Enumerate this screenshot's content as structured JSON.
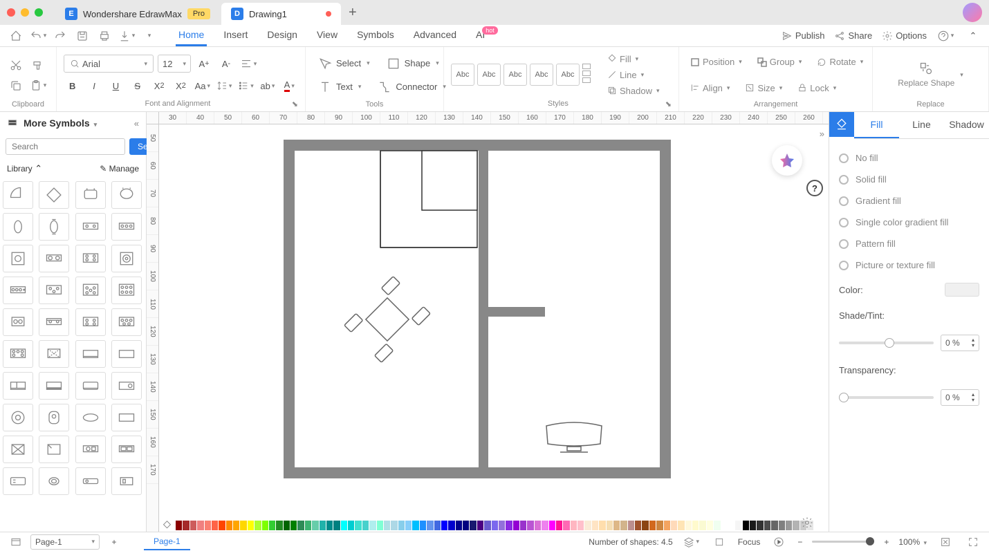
{
  "titlebar": {
    "app_name": "Wondershare EdrawMax",
    "pro_badge": "Pro",
    "doc_name": "Drawing1"
  },
  "menu": {
    "tabs": [
      "Home",
      "Insert",
      "Design",
      "View",
      "Symbols",
      "Advanced",
      "AI"
    ],
    "active": "Home",
    "hot_badge": "hot"
  },
  "top_actions": {
    "publish": "Publish",
    "share": "Share",
    "options": "Options"
  },
  "ribbon": {
    "clipboard_label": "Clipboard",
    "font_label": "Font and Alignment",
    "tools_label": "Tools",
    "styles_label": "Styles",
    "arrangement_label": "Arrangement",
    "replace_label": "Replace",
    "font_family": "Arial",
    "font_size": "12",
    "select": "Select",
    "shape": "Shape",
    "text": "Text",
    "connector": "Connector",
    "style_preview": "Abc",
    "fill": "Fill",
    "line": "Line",
    "shadow": "Shadow",
    "position": "Position",
    "group": "Group",
    "rotate": "Rotate",
    "align": "Align",
    "size": "Size",
    "lock": "Lock",
    "replace_shape": "Replace Shape"
  },
  "left_panel": {
    "title": "More Symbols",
    "search_placeholder": "Search",
    "search_btn": "Search",
    "library": "Library",
    "manage": "Manage"
  },
  "right_panel": {
    "tabs": [
      "Fill",
      "Line",
      "Shadow"
    ],
    "active": "Fill",
    "options": [
      "No fill",
      "Solid fill",
      "Gradient fill",
      "Single color gradient fill",
      "Pattern fill",
      "Picture or texture fill"
    ],
    "color_label": "Color:",
    "shade_label": "Shade/Tint:",
    "shade_value": "0 %",
    "transparency_label": "Transparency:",
    "transparency_value": "0 %"
  },
  "ruler_h": [
    "30",
    "40",
    "50",
    "60",
    "70",
    "80",
    "90",
    "100",
    "110",
    "120",
    "130",
    "140",
    "150",
    "160",
    "170",
    "180",
    "190",
    "200",
    "210",
    "220",
    "230",
    "240",
    "250",
    "260"
  ],
  "ruler_v": [
    "50",
    "60",
    "70",
    "80",
    "90",
    "100",
    "110",
    "120",
    "130",
    "140",
    "150",
    "160",
    "170"
  ],
  "statusbar": {
    "page_select": "Page-1",
    "page_tab": "Page-1",
    "shapes_count": "Number of shapes: 4.5",
    "focus": "Focus",
    "zoom": "100%"
  },
  "color_palette": [
    "#8b0000",
    "#a52a2a",
    "#cd5c5c",
    "#f08080",
    "#fa8072",
    "#ff6347",
    "#ff4500",
    "#ff8c00",
    "#ffa500",
    "#ffd700",
    "#ffff00",
    "#adff2f",
    "#7fff00",
    "#32cd32",
    "#228b22",
    "#006400",
    "#008000",
    "#2e8b57",
    "#3cb371",
    "#66cdaa",
    "#20b2aa",
    "#008b8b",
    "#008080",
    "#00ffff",
    "#00ced1",
    "#40e0d0",
    "#48d1cc",
    "#afeeee",
    "#7fffd4",
    "#b0e0e6",
    "#add8e6",
    "#87ceeb",
    "#87cefa",
    "#00bfff",
    "#1e90ff",
    "#6495ed",
    "#4169e1",
    "#0000ff",
    "#0000cd",
    "#00008b",
    "#000080",
    "#191970",
    "#4b0082",
    "#6a5acd",
    "#7b68ee",
    "#9370db",
    "#8a2be2",
    "#9400d3",
    "#9932cc",
    "#ba55d3",
    "#da70d6",
    "#ee82ee",
    "#ff00ff",
    "#ff1493",
    "#ff69b4",
    "#ffb6c1",
    "#ffc0cb",
    "#faebd7",
    "#ffe4c4",
    "#ffdead",
    "#f5deb3",
    "#deb887",
    "#d2b48c",
    "#bc8f8f",
    "#a0522d",
    "#8b4513",
    "#d2691e",
    "#cd853f",
    "#f4a460",
    "#ffdab9",
    "#ffe4b5",
    "#fff8dc",
    "#fffacd",
    "#fafad2",
    "#ffffe0",
    "#f0fff0"
  ],
  "gray_palette": [
    "#ffffff",
    "#f5f5f5",
    "#000000",
    "#1a1a1a",
    "#333333",
    "#4d4d4d",
    "#666666",
    "#808080",
    "#999999",
    "#b3b3b3",
    "#cccccc",
    "#e6e6e6"
  ]
}
